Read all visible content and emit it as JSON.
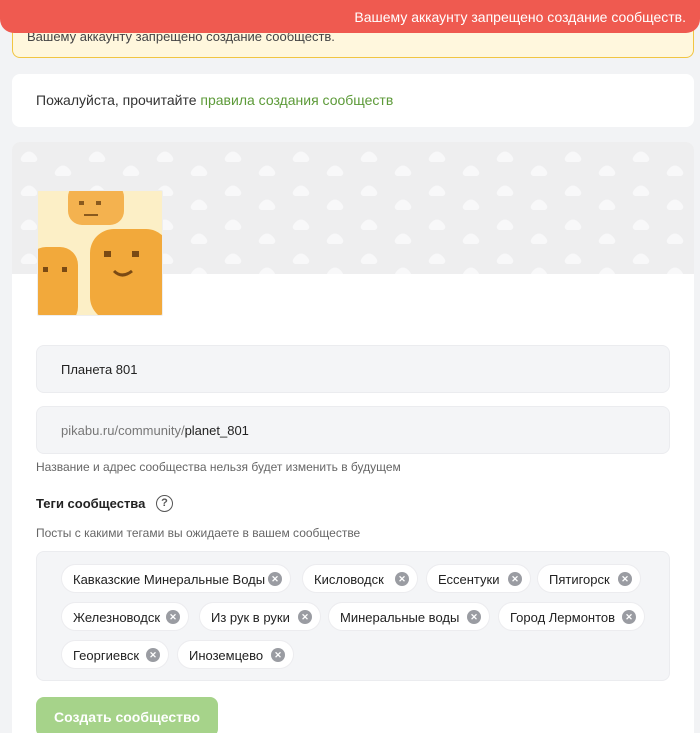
{
  "toast": {
    "message": "Вашему аккаунту запрещено создание сообществ."
  },
  "warning": {
    "text": "Вашему аккаунту запрещено создание сообществ."
  },
  "rules": {
    "prefix": "Пожалуйста, прочитайте ",
    "link": "правила создания сообществ"
  },
  "form": {
    "name_value": "Планета 801",
    "url_prefix": "pikabu.ru/community/",
    "url_slug": "planet_801",
    "name_hint": "Название и адрес сообщества нельзя будет изменить в будущем",
    "tags_title": "Теги сообщества",
    "help_glyph": "?",
    "tags_hint": "Посты с какими тегами вы ожидаете в вашем сообществе",
    "tags": [
      "Кавказские Минеральные Воды",
      "Кисловодск",
      "Ессентуки",
      "Пятигорск",
      "Железноводск",
      "Из рук в руки",
      "Минеральные воды",
      "Город Лермонтов",
      "Георгиевск",
      "Иноземцево"
    ],
    "remove_glyph": "✕",
    "submit_label": "Создать сообщество"
  },
  "colors": {
    "accent_link": "#5c9a38",
    "toast_bg": "#ef5a50",
    "submit_bg": "#a6d38a",
    "warning_border": "#f1c542"
  },
  "icons": {
    "tag_remove": "close-circle-icon",
    "help": "question-circle-icon"
  }
}
